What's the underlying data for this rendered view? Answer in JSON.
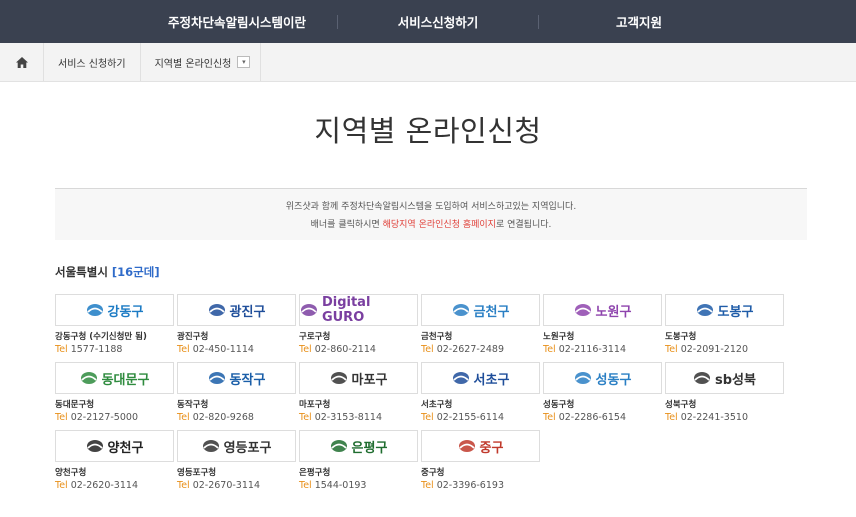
{
  "nav": {
    "items": [
      "주정차단속알림시스템이란",
      "서비스신청하기",
      "고객지원"
    ]
  },
  "breadcrumb": {
    "home_icon": "home-icon",
    "service": "서비스 신청하기",
    "current": "지역별 온라인신청",
    "dropdown_icon": "chevron-down-icon"
  },
  "page_title": "지역별 온라인신청",
  "notice": {
    "line1": "위즈샷과 함께 주정차단속알림시스템을 도입하여 서비스하고있는 지역입니다.",
    "line2_pre": "배너를 클릭하시면 ",
    "line2_hl": "해당지역 온라인신청 홈페이지",
    "line2_post": "로 연결됩니다."
  },
  "region": {
    "name": "서울특별시 ",
    "count": "[16군데]"
  },
  "tel_label": "Tel",
  "districts": [
    {
      "logo": "강동구",
      "name": "강동구청 (수기신청만 됨)",
      "tel": "1577-1188",
      "color": "#1c7bc4"
    },
    {
      "logo": "광진구",
      "name": "광진구청",
      "tel": "02-450-1114",
      "color": "#1f4e9a"
    },
    {
      "logo": "Digital GURO",
      "name": "구로구청",
      "tel": "02-860-2114",
      "color": "#7a3fa0"
    },
    {
      "logo": "금천구",
      "name": "금천구청",
      "tel": "02-2627-2489",
      "color": "#2a7fc4"
    },
    {
      "logo": "노원구",
      "name": "노원구청",
      "tel": "02-2116-3114",
      "color": "#8e44ad"
    },
    {
      "logo": "도봉구",
      "name": "도봉구청",
      "tel": "02-2091-2120",
      "color": "#1f5ca8"
    },
    {
      "logo": "동대문구",
      "name": "동대문구청",
      "tel": "02-2127-5000",
      "color": "#2e8b3e"
    },
    {
      "logo": "동작구",
      "name": "동작구청",
      "tel": "02-820-9268",
      "color": "#1a5ea8"
    },
    {
      "logo": "마포구",
      "name": "마포구청",
      "tel": "02-3153-8114",
      "color": "#333333"
    },
    {
      "logo": "서초구",
      "name": "서초구청",
      "tel": "02-2155-6114",
      "color": "#1f4e9a"
    },
    {
      "logo": "성동구",
      "name": "성동구청",
      "tel": "02-2286-6154",
      "color": "#2a7fc4"
    },
    {
      "logo": "sb성북",
      "name": "성북구청",
      "tel": "02-2241-3510",
      "color": "#333333"
    },
    {
      "logo": "양천구",
      "name": "양천구청",
      "tel": "02-2620-3114",
      "color": "#222222"
    },
    {
      "logo": "영등포구",
      "name": "영등포구청",
      "tel": "02-2670-3114",
      "color": "#333333"
    },
    {
      "logo": "은평구",
      "name": "은평구청",
      "tel": "1544-0193",
      "color": "#1f6d2f"
    },
    {
      "logo": "중구",
      "name": "중구청",
      "tel": "02-3396-6193",
      "color": "#c0392b"
    }
  ]
}
